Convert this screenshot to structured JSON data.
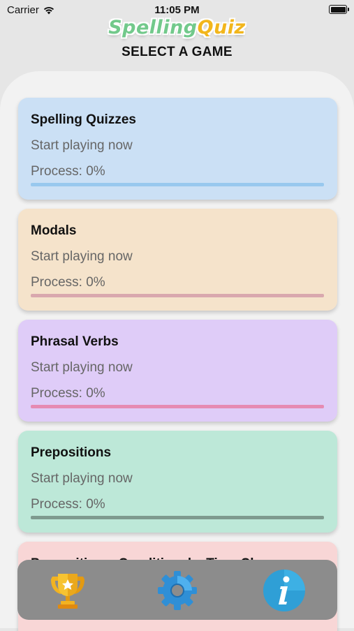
{
  "status_bar": {
    "carrier": "Carrier",
    "time": "11:05 PM"
  },
  "header": {
    "logo_part1": "Spelling",
    "logo_part2": "Quiz",
    "title": "SELECT A GAME"
  },
  "games": [
    {
      "title": "Spelling Quizzes",
      "subtitle": "Start playing now",
      "progress_text": "Process: 0%",
      "progress": 0,
      "bg": "#cbe0f5",
      "bar": "#98c8ee"
    },
    {
      "title": "Modals",
      "subtitle": "Start playing now",
      "progress_text": "Process: 0%",
      "progress": 0,
      "bg": "#f5e3cb",
      "bar": "#d9a8ae"
    },
    {
      "title": "Phrasal Verbs",
      "subtitle": "Start playing now",
      "progress_text": "Process: 0%",
      "progress": 0,
      "bg": "#dfccf8",
      "bar": "#e68bb3"
    },
    {
      "title": "Prepositions",
      "subtitle": "Start playing now",
      "progress_text": "Process: 0%",
      "progress": 0,
      "bg": "#bde8d8",
      "bar": "#7e9a8e"
    },
    {
      "title": "Prepositions, Conditionals, Time Clauses",
      "subtitle": "",
      "progress_text": "",
      "progress": 0,
      "bg": "#f8d6d6",
      "bar": "#e0a0a0"
    }
  ],
  "tabbar": {
    "icons": [
      "trophy-icon",
      "settings-gear-icon",
      "info-icon"
    ]
  }
}
